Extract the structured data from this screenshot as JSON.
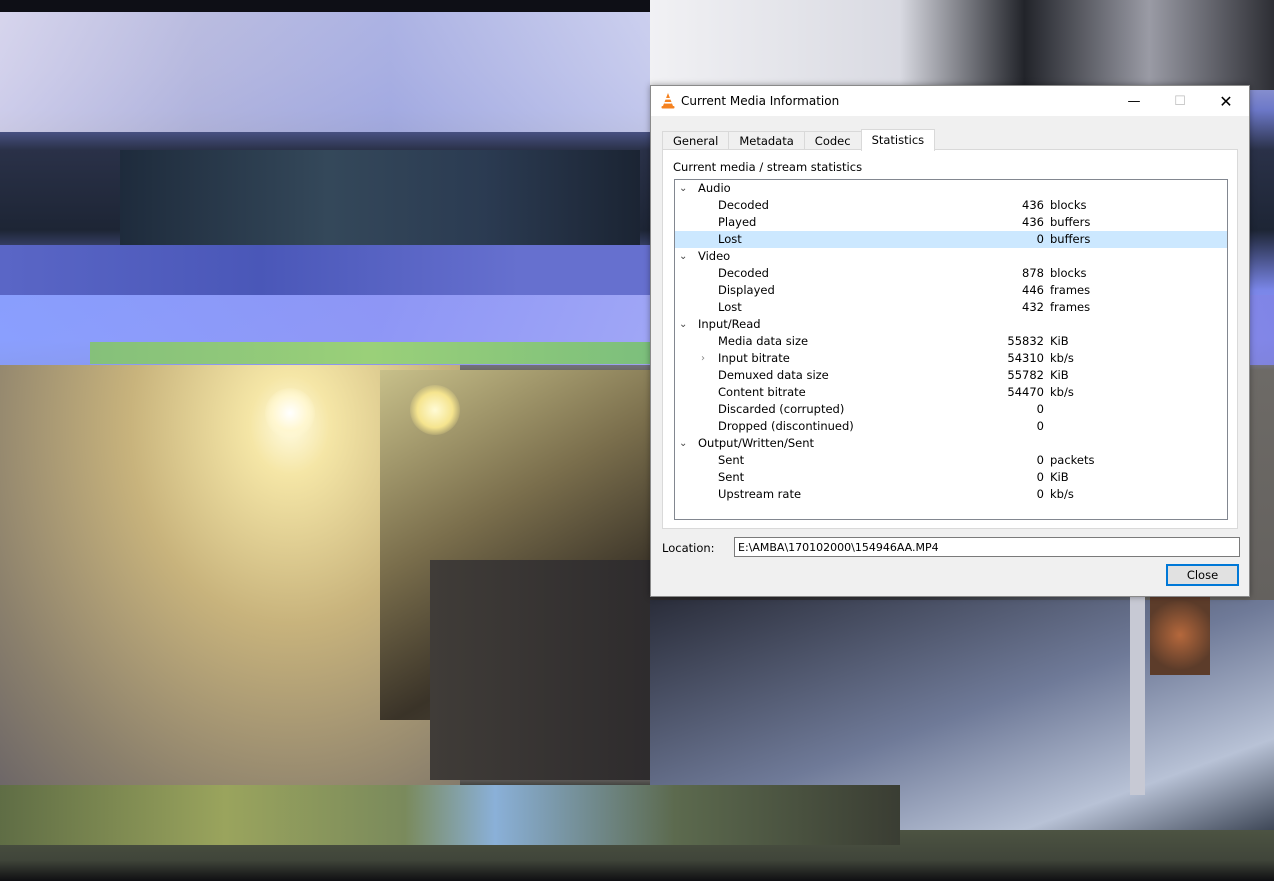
{
  "window": {
    "title": "Current Media Information",
    "icon": "vlc-cone-icon",
    "controls": [
      "minimize",
      "maximize",
      "close"
    ]
  },
  "tabs": [
    {
      "label": "General",
      "active": false
    },
    {
      "label": "Metadata",
      "active": false
    },
    {
      "label": "Codec",
      "active": false
    },
    {
      "label": "Statistics",
      "active": true
    }
  ],
  "statistics": {
    "caption": "Current media / stream statistics",
    "categories": [
      {
        "label": "Audio",
        "items": [
          {
            "label": "Decoded",
            "value": "436",
            "unit": "blocks"
          },
          {
            "label": "Played",
            "value": "436",
            "unit": "buffers"
          },
          {
            "label": "Lost",
            "value": "0",
            "unit": "buffers",
            "selected": true
          }
        ]
      },
      {
        "label": "Video",
        "items": [
          {
            "label": "Decoded",
            "value": "878",
            "unit": "blocks"
          },
          {
            "label": "Displayed",
            "value": "446",
            "unit": "frames"
          },
          {
            "label": "Lost",
            "value": "432",
            "unit": "frames"
          }
        ]
      },
      {
        "label": "Input/Read",
        "items": [
          {
            "label": "Media data size",
            "value": "55832",
            "unit": "KiB"
          },
          {
            "label": "Input bitrate",
            "value": "54310",
            "unit": "kb/s",
            "expandable": true
          },
          {
            "label": "Demuxed data size",
            "value": "55782",
            "unit": "KiB"
          },
          {
            "label": "Content bitrate",
            "value": "54470",
            "unit": "kb/s"
          },
          {
            "label": "Discarded (corrupted)",
            "value": "0",
            "unit": ""
          },
          {
            "label": "Dropped (discontinued)",
            "value": "0",
            "unit": ""
          }
        ]
      },
      {
        "label": "Output/Written/Sent",
        "items": [
          {
            "label": "Sent",
            "value": "0",
            "unit": "packets"
          },
          {
            "label": "Sent",
            "value": "0",
            "unit": "KiB"
          },
          {
            "label": "Upstream rate",
            "value": "0",
            "unit": "kb/s"
          }
        ]
      }
    ]
  },
  "location": {
    "label": "Location:",
    "value": "E:\\AMBA\\170102000\\154946AA.MP4"
  },
  "buttons": {
    "close": "Close"
  },
  "colors": {
    "selection": "#cce8ff",
    "accent": "#0078d7"
  }
}
